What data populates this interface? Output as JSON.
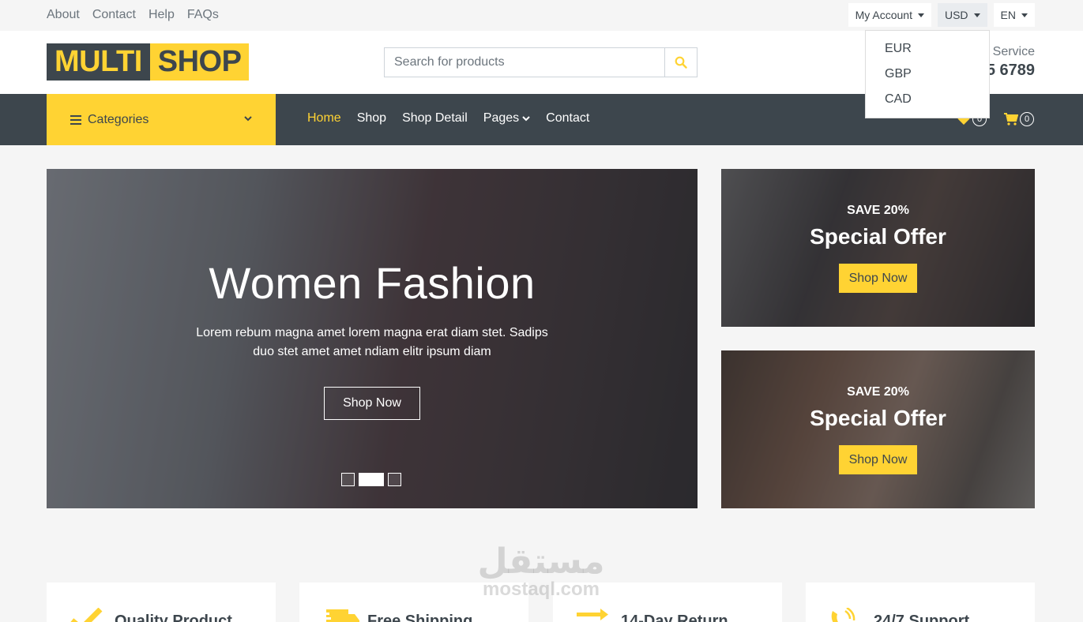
{
  "topbar": {
    "links": [
      "About",
      "Contact",
      "Help",
      "FAQs"
    ],
    "my_account": "My Account",
    "currency": "USD",
    "language": "EN"
  },
  "currency_dropdown": {
    "options": [
      "EUR",
      "GBP",
      "CAD"
    ]
  },
  "header": {
    "logo_part1": "MULTI",
    "logo_part2": "SHOP",
    "search_placeholder": "Search for products",
    "customer_service_label": "Service",
    "phone": "5 6789"
  },
  "navbar": {
    "categories_label": "Categories",
    "links": [
      "Home",
      "Shop",
      "Shop Detail",
      "Pages",
      "Contact"
    ],
    "active": "Home",
    "wishlist_count": "0",
    "cart_count": "0"
  },
  "carousel": {
    "title": "Women Fashion",
    "description": "Lorem rebum magna amet lorem magna erat diam stet. Sadips duo stet amet amet ndiam elitr ipsum diam",
    "button": "Shop Now",
    "slide_count": 3,
    "active_slide": 2
  },
  "offers": [
    {
      "save": "SAVE 20%",
      "title": "Special Offer",
      "button": "Shop Now"
    },
    {
      "save": "SAVE 20%",
      "title": "Special Offer",
      "button": "Shop Now"
    }
  ],
  "features": [
    {
      "title": "Quality Product",
      "icon": "check-icon"
    },
    {
      "title": "Free Shipping",
      "icon": "shipping-icon"
    },
    {
      "title": "14-Day Return",
      "icon": "exchange-icon"
    },
    {
      "title": "24/7 Support",
      "icon": "phone-icon"
    }
  ],
  "watermark": {
    "arabic": "مستقل",
    "latin": "mostaql.com"
  },
  "colors": {
    "accent": "#ffd333",
    "dark": "#3d464d",
    "light_bg": "#f5f5f5"
  }
}
